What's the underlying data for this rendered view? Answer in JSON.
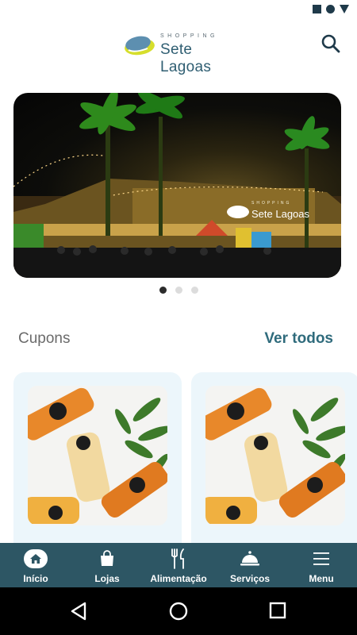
{
  "header": {
    "logo_small": "SHOPPING",
    "logo_main": "Sete Lagoas",
    "search_icon": "search-icon"
  },
  "carousel": {
    "slides": 3,
    "active_index": 0,
    "sign_text": "Sete Lagoas",
    "sign_small": "SHOPPING"
  },
  "coupons": {
    "title": "Cupons",
    "see_all": "Ver todos"
  },
  "bottom_nav": {
    "items": [
      {
        "label": "Início",
        "icon": "home-icon"
      },
      {
        "label": "Lojas",
        "icon": "shopping-bag-icon"
      },
      {
        "label": "Alimentação",
        "icon": "fork-knife-icon"
      },
      {
        "label": "Serviços",
        "icon": "service-bell-icon"
      },
      {
        "label": "Menu",
        "icon": "hamburger-icon"
      }
    ]
  },
  "colors": {
    "brand_teal": "#2f6b7c",
    "nav_bg": "#2d5664",
    "card_bg": "#ecf6fb"
  }
}
